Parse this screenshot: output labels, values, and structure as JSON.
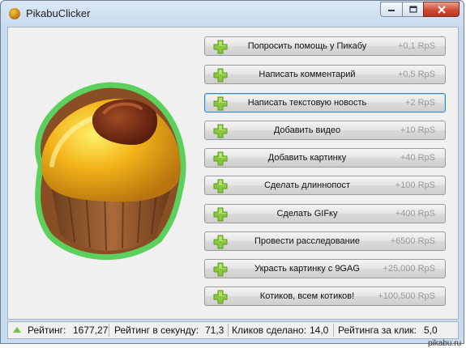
{
  "window": {
    "title": "PikabuClicker",
    "min_icon": "minimize-icon",
    "max_icon": "maximize-icon",
    "close_icon": "close-icon"
  },
  "colors": {
    "button_text": "#111111",
    "rate_text": "#9a9a9a",
    "plus_green": "#8cc63f",
    "cupcake_outline": "#5cd05c"
  },
  "buttons": [
    {
      "label": "Попросить помощь у Пикабу",
      "rate": "+0,1 RpS"
    },
    {
      "label": "Написать комментарий",
      "rate": "+0,5 RpS"
    },
    {
      "label": "Написать текстовую новость",
      "rate": "+2 RpS"
    },
    {
      "label": "Добавить видео",
      "rate": "+10 RpS"
    },
    {
      "label": "Добавить картинку",
      "rate": "+40 RpS"
    },
    {
      "label": "Сделать длиннопост",
      "rate": "+100 RpS"
    },
    {
      "label": "Сделать GIFку",
      "rate": "+400 RpS"
    },
    {
      "label": "Провести расследование",
      "rate": "+6500 RpS"
    },
    {
      "label": "Украсть картинку с 9GAG",
      "rate": "+25,000 RpS"
    },
    {
      "label": "Котиков, всем котиков!",
      "rate": "+100,500 RpS"
    }
  ],
  "status": {
    "rating_label": "Рейтинг:",
    "rating_value": "1677,27",
    "rps_label": "Рейтинг в секунду:",
    "rps_value": "71,3",
    "clicks_label": "Кликов сделано:",
    "clicks_value": "14,0",
    "per_click_label": "Рейтинга за клик:",
    "per_click_value": "5,0"
  },
  "watermark": "pikabu.ru"
}
